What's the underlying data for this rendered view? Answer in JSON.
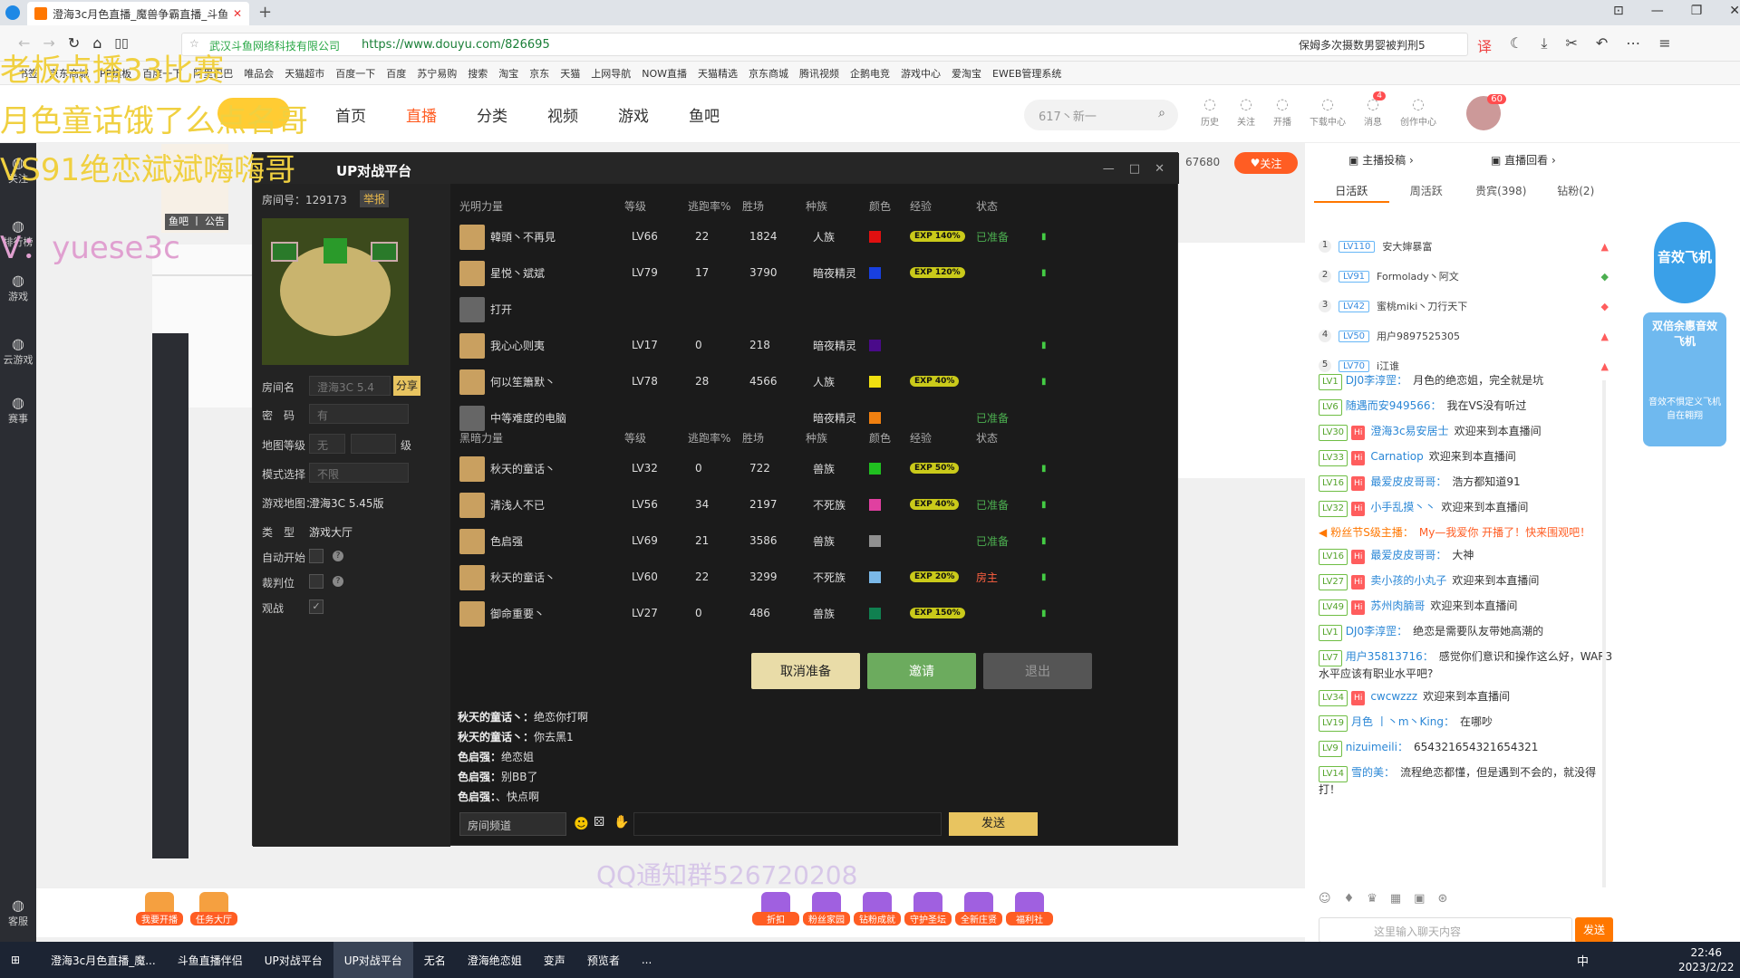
{
  "browser": {
    "tab_title": "澄海3c月色直播_魔兽争霸直播_斗鱼",
    "site_owner": "武汉斗鱼网络科技有限公司",
    "url": "https://www.douyu.com/826695",
    "news_text": "保姆多次摄数男婴被判刑5",
    "bookmarks": [
      "书签",
      "京东商城",
      "PP棋板",
      "百度一下",
      "阿里巴巴",
      "唯品会",
      "天猫超市",
      "百度一下",
      "百度",
      "苏宁易购",
      "搜索",
      "淘宝",
      "京东",
      "天猫",
      "上网导航",
      "NOW直播",
      "天猫精选",
      "京东商城",
      "腾讯视频",
      "企鹅电竞",
      "游戏中心",
      "爱淘宝",
      "EWEB管理系统"
    ]
  },
  "douyu": {
    "nav": [
      "首页",
      "直播",
      "分类",
      "视频",
      "游戏",
      "鱼吧"
    ],
    "search_placeholder": "617丶新一",
    "icons": [
      {
        "label": "历史",
        "icon": "history-icon"
      },
      {
        "label": "关注",
        "icon": "heart-icon"
      },
      {
        "label": "开播",
        "icon": "camera-icon"
      },
      {
        "label": "下载中心",
        "icon": "download-icon"
      },
      {
        "label": "消息",
        "icon": "bell-icon",
        "badge": "4"
      },
      {
        "label": "创作中心",
        "icon": "create-icon"
      }
    ],
    "avatar_badge": "60",
    "follow_count": "67680",
    "follow_label": "关注",
    "fishbar_label": "鱼吧 丨 公告",
    "left_menu": [
      "关注",
      "排行榜",
      "游戏",
      "云游戏",
      "赛事",
      "客服"
    ]
  },
  "overlays": {
    "line1": "老板点播33比赛",
    "line2": "月色童话饿了么点名哥",
    "line3": "VS91绝恋斌斌嗨嗨哥",
    "line4": "V：yuese3c",
    "qq1": "QQ通知群526720208",
    "qq2": "QQ通知群526720208"
  },
  "up": {
    "title": "UP对战平台",
    "room_no": "房间号：129173",
    "report": "举报",
    "room_name_label": "房间名",
    "room_name": "澄海3C 5.4",
    "share": "分享",
    "password_label": "密　码",
    "password": "有",
    "map_level_label": "地图等级",
    "map_level": "无",
    "level_unit": "级",
    "mode_label": "模式选择",
    "mode": "不限",
    "game_map_label": "游戏地图：",
    "game_map": "澄海3C 5.45版",
    "type_label": "类　型",
    "type": "游戏大厅",
    "auto_start_label": "自动开始",
    "judge_label": "裁判位",
    "watch_label": "观战",
    "headers": [
      "等级",
      "逃跑率%",
      "胜场",
      "种族",
      "颜色",
      "经验",
      "状态"
    ],
    "team_light": "光明力量",
    "team_dark": "黑暗力量",
    "light": [
      {
        "name": "韓頭丶不再見",
        "lv": "LV66",
        "esc": "22",
        "win": "1824",
        "race": "人族",
        "color": "#e01010",
        "exp": "EXP 140%",
        "status": "已准备"
      },
      {
        "name": "星悦丶斌斌",
        "lv": "LV79",
        "esc": "17",
        "win": "3790",
        "race": "暗夜精灵",
        "color": "#1840e0",
        "exp": "EXP 120%",
        "status": ""
      },
      {
        "name": "打开",
        "lv": "",
        "esc": "",
        "win": "",
        "race": "",
        "color": "",
        "exp": "",
        "status": ""
      },
      {
        "name": "我心心则夷",
        "lv": "LV17",
        "esc": "0",
        "win": "218",
        "race": "暗夜精灵",
        "color": "#4a0a8a",
        "exp": "",
        "status": ""
      },
      {
        "name": "何以笙簫默丶",
        "lv": "LV78",
        "esc": "28",
        "win": "4566",
        "race": "人族",
        "color": "#f0e010",
        "exp": "EXP 40%",
        "status": ""
      },
      {
        "name": "中等难度的电脑",
        "lv": "",
        "esc": "",
        "win": "",
        "race": "暗夜精灵",
        "color": "#f08010",
        "exp": "",
        "status": "已准备"
      }
    ],
    "dark": [
      {
        "name": "秋天的童话丶",
        "lv": "LV32",
        "esc": "0",
        "win": "722",
        "race": "兽族",
        "color": "#20c020",
        "exp": "EXP 50%",
        "status": ""
      },
      {
        "name": "清浅人不已",
        "lv": "LV56",
        "esc": "34",
        "win": "2197",
        "race": "不死族",
        "color": "#e040a0",
        "exp": "EXP 40%",
        "status": "已准备"
      },
      {
        "name": "色启强",
        "lv": "LV69",
        "esc": "21",
        "win": "3586",
        "race": "兽族",
        "color": "#909090",
        "exp": "",
        "status": "已准备"
      },
      {
        "name": "秋天的童话丶",
        "lv": "LV60",
        "esc": "22",
        "win": "3299",
        "race": "不死族",
        "color": "#7ab8e8",
        "exp": "EXP 20%",
        "status": "房主"
      },
      {
        "name": "御命重要丶",
        "lv": "LV27",
        "esc": "0",
        "win": "486",
        "race": "兽族",
        "color": "#108050",
        "exp": "EXP 150%",
        "status": ""
      }
    ],
    "btn_cancel": "取消准备",
    "btn_invite": "邀请",
    "btn_exit": "退出",
    "chat": [
      {
        "who": "秋天的童话丶：",
        "msg": "绝恋你打啊"
      },
      {
        "who": "秋天的童话丶：",
        "msg": "你去黑1"
      },
      {
        "who": "色启强：",
        "msg": "绝恋姐"
      },
      {
        "who": "色启强：",
        "msg": "别BB了"
      },
      {
        "who": "色启强：",
        "msg": "、快点啊"
      }
    ],
    "channel": "房间频道",
    "send": "发送"
  },
  "right": {
    "anchor_submit": "主播投稿",
    "replay": "直播回看",
    "tabs": [
      "日活跃",
      "周活跃",
      "贵宾(398)",
      "钻粉(2)"
    ],
    "rank": [
      {
        "no": "1",
        "lv": "LV110",
        "name": "安大婶暴富"
      },
      {
        "no": "2",
        "lv": "LV91",
        "name": "Formolady丶阿文"
      },
      {
        "no": "3",
        "lv": "LV42",
        "name": "蜜桃miki丶刀行天下"
      },
      {
        "no": "4",
        "lv": "LV50",
        "name": "用户9897525305"
      },
      {
        "no": "5",
        "lv": "LV70",
        "name": "i江谁"
      }
    ],
    "chat": [
      {
        "lv": "LV1",
        "name": "DJ0李淳罡：",
        "msg": "月色的绝恋姐，完全就是坑",
        "hi": false
      },
      {
        "lv": "LV6",
        "name": "随遇而安949566：",
        "msg": "我在VS没有听过",
        "hi": false
      },
      {
        "lv": "LV30",
        "name": "澄海3c易安居士",
        "msg": "欢迎来到本直播间",
        "hi": true
      },
      {
        "lv": "LV33",
        "name": "Carnatiop",
        "msg": "欢迎来到本直播间",
        "hi": true
      },
      {
        "lv": "LV16",
        "name": "最爱皮皮哥哥：",
        "msg": "浩方都知道91",
        "hi": true
      },
      {
        "lv": "LV32",
        "name": "小手乱摸丶丶",
        "msg": "欢迎来到本直播间",
        "hi": true
      },
      {
        "lv": "",
        "name": "粉丝节S级主播：",
        "msg": "My—我爱你 开播了！快来围观吧！",
        "hi": false
      },
      {
        "lv": "LV16",
        "name": "最爱皮皮哥哥：",
        "msg": "大神",
        "hi": true
      },
      {
        "lv": "LV27",
        "name": "卖小孩的小丸子",
        "msg": "欢迎来到本直播间",
        "hi": true
      },
      {
        "lv": "LV49",
        "name": "苏州肉腩哥",
        "msg": "欢迎来到本直播间",
        "hi": true
      },
      {
        "lv": "LV1",
        "name": "DJ0李淳罡：",
        "msg": "绝恋是需要队友带她高潮的",
        "hi": false
      },
      {
        "lv": "LV7",
        "name": "用户35813716：",
        "msg": "感觉你们意识和操作这么好，WAR3水平应该有职业水平吧?",
        "hi": false
      },
      {
        "lv": "LV34",
        "name": "cwcwzzz",
        "msg": "欢迎来到本直播间",
        "hi": true
      },
      {
        "lv": "LV19",
        "name": "月色 丨丶m丶King：",
        "msg": "在哪吵",
        "hi": false
      },
      {
        "lv": "LV9",
        "name": "nizuimeili：",
        "msg": "654321654321654321",
        "hi": false
      },
      {
        "lv": "LV14",
        "name": "雪的美：",
        "msg": "流程绝恋都懂，但是遇到不会的，就没得打！",
        "hi": false
      }
    ],
    "input_placeholder": "这里输入聊天内容",
    "send": "发送",
    "promo1": "音效飞机",
    "promo2": "双倍余惠音效飞机",
    "promo3": "音效不惧定义飞机自在翱翔"
  },
  "gifts": [
    "我要开播",
    "任务大厅",
    "折扣",
    "粉丝家园",
    "钻粉成就",
    "守护圣坛",
    "全新庄贤",
    "福利社"
  ],
  "taskbar": {
    "items": [
      "澄海3c月色直播_魔...",
      "斗鱼直播伴侣",
      "UP对战平台",
      "UP对战平台",
      "无名",
      "澄海绝恋姐",
      "变声",
      "预览者",
      "..."
    ],
    "ime": "中",
    "time": "22:46",
    "date": "2023/2/22"
  }
}
